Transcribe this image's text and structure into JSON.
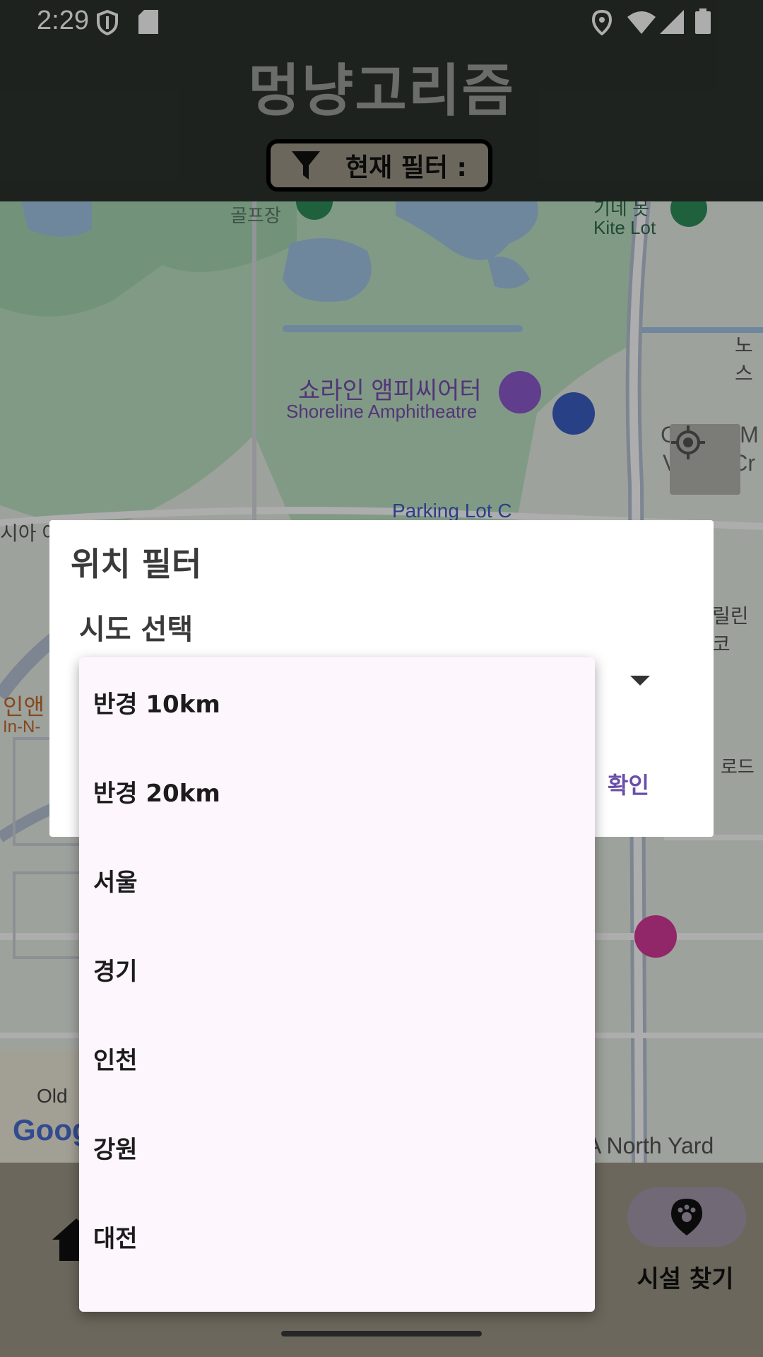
{
  "status_bar": {
    "time": "2:29"
  },
  "header": {
    "title": "멍냥고리즘",
    "filter_label": "현재 필터 :"
  },
  "map": {
    "labels": {
      "golf": "골프장",
      "kite_ko": "기네 못",
      "kite_en": "Kite Lot",
      "shoreline_ko": "쇼라인 앰피씨어터",
      "shoreline_en": "Shoreline Amphitheatre",
      "parking": "Parking Lot C",
      "google_ko": "Google M",
      "google_en": "View - Cr",
      "road_vertical": "노스 쇼어라인 대로",
      "nosu": "노스",
      "inn_ko": "인앤",
      "inn_en": "In-N-",
      "siah": "시아 어",
      "charleston": "릴린 코",
      "road_right": "로드",
      "old": "Old",
      "north_yard": "A North Yard",
      "google_logo": "Goog"
    }
  },
  "dialog": {
    "title": "위치 필터",
    "sublabel": "시도 선택",
    "confirm": "확인"
  },
  "dropdown": {
    "items": [
      "반경 10km",
      "반경 20km",
      "서울",
      "경기",
      "인천",
      "강원",
      "대전"
    ]
  },
  "bottom_nav": {
    "find_label": "시설 찾기"
  },
  "colors": {
    "header": "#2c332d",
    "accent": "#6a4fa8",
    "nav": "#a09888",
    "popup": "#fdf6fd"
  }
}
